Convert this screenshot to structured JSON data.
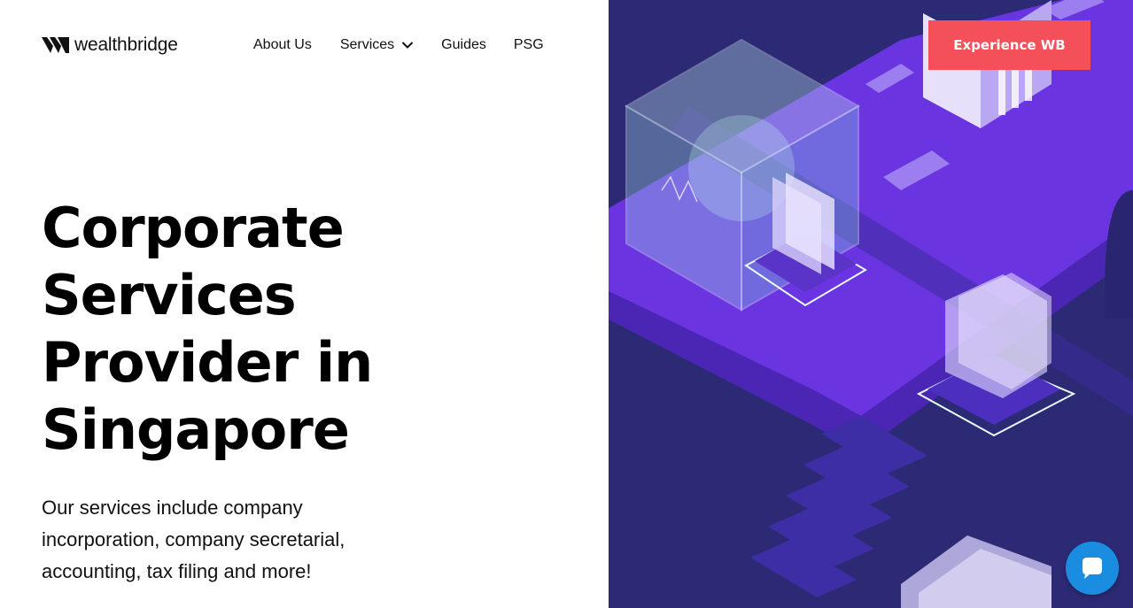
{
  "brand": {
    "name": "wealthbridge"
  },
  "nav": {
    "items": [
      {
        "label": "About Us"
      },
      {
        "label": "Services"
      },
      {
        "label": "Guides"
      },
      {
        "label": "PSG"
      }
    ]
  },
  "hero": {
    "title_lines": [
      "Corporate",
      "Services",
      "Provider in",
      "Singapore"
    ],
    "subtitle": "Our services include company incorporation, company secretarial, accounting, tax filing and more!"
  },
  "cta": {
    "label": "Experience WB"
  },
  "colors": {
    "accent": "#f4505a",
    "illustration_bg": "#2c2a74",
    "illustration_purple": "#6a35e0",
    "chat": "#1a8de0"
  },
  "icons": {
    "logo": "wealthbridge-logo-icon",
    "services_dropdown": "chevron-down-icon",
    "chat": "chat-bubble-icon"
  }
}
